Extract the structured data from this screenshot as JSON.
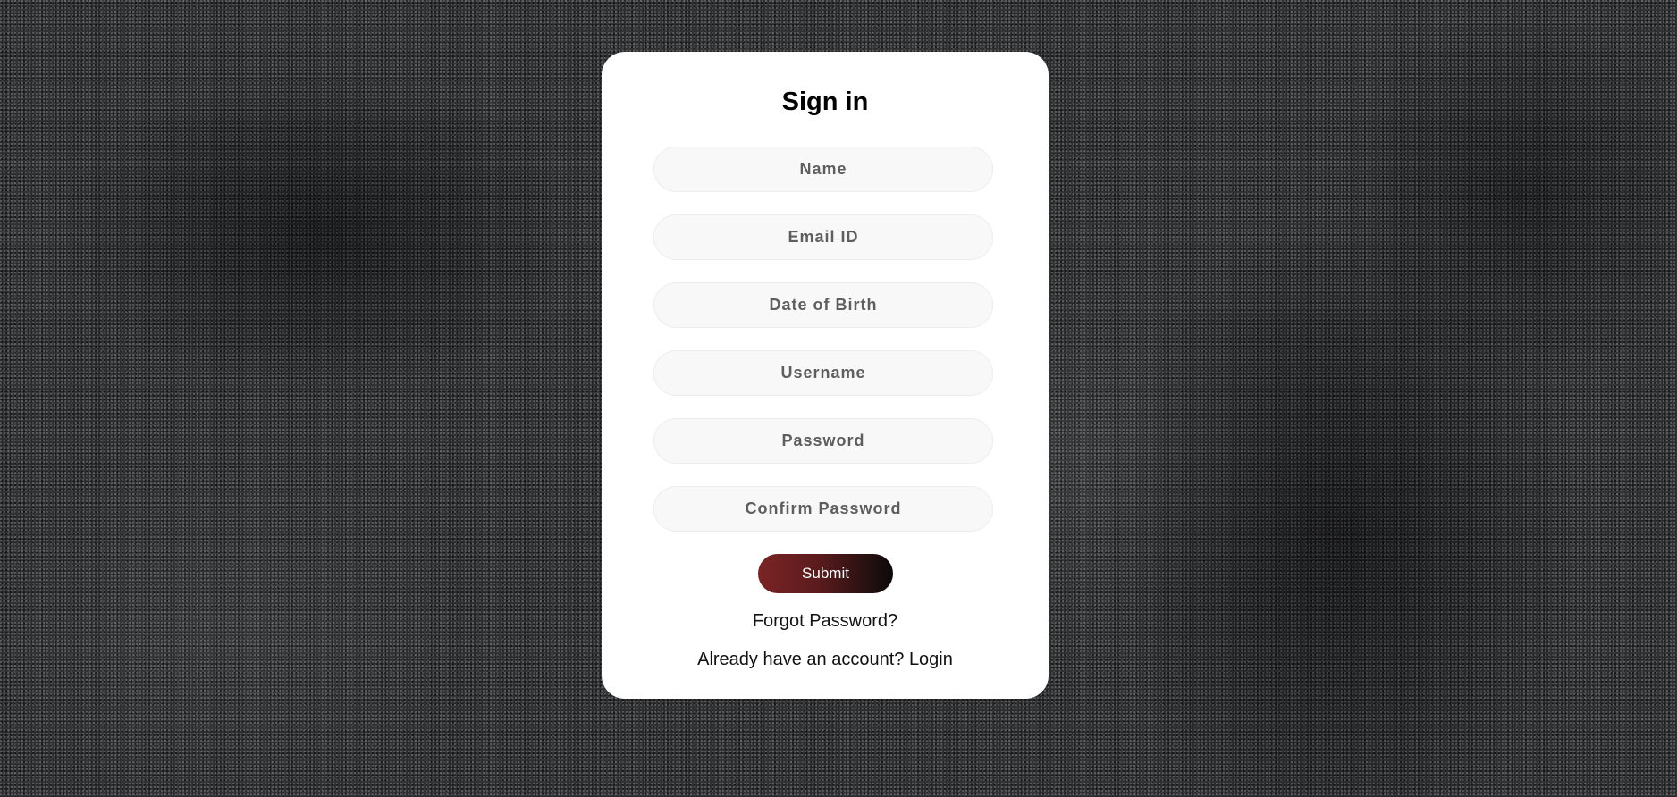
{
  "form": {
    "title": "Sign in",
    "fields": [
      {
        "placeholder": "Name",
        "value": ""
      },
      {
        "placeholder": "Email ID",
        "value": ""
      },
      {
        "placeholder": "Date of Birth",
        "value": ""
      },
      {
        "placeholder": "Username",
        "value": ""
      },
      {
        "placeholder": "Password",
        "value": ""
      },
      {
        "placeholder": "Confirm Password",
        "value": ""
      }
    ],
    "submit_label": "Submit",
    "forgot_password_label": "Forgot Password?",
    "account_prompt": "Already have an account? ",
    "login_label": "Login"
  },
  "colors": {
    "card_background": "#ffffff",
    "field_background": "#f8f8f8",
    "submit_gradient_start": "#7a2424",
    "submit_gradient_end": "#0c0a0a",
    "page_background": "#2a2b2d"
  }
}
